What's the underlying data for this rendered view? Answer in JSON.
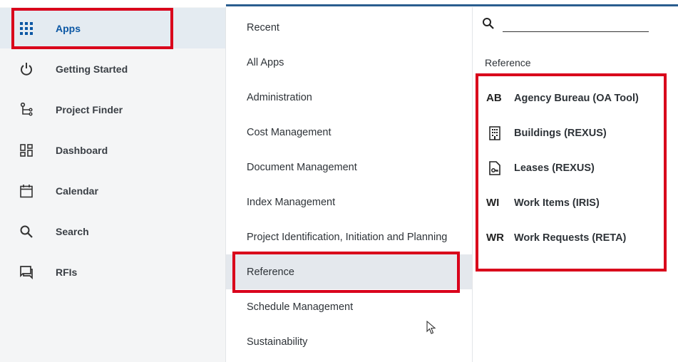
{
  "nav": {
    "items": [
      {
        "label": "Apps",
        "icon": "apps-grid-icon",
        "active": true
      },
      {
        "label": "Getting Started",
        "icon": "power-icon"
      },
      {
        "label": "Project Finder",
        "icon": "tree-icon"
      },
      {
        "label": "Dashboard",
        "icon": "dashboard-icon"
      },
      {
        "label": "Calendar",
        "icon": "calendar-icon"
      },
      {
        "label": "Search",
        "icon": "search-icon"
      },
      {
        "label": "RFIs",
        "icon": "rfi-icon"
      }
    ]
  },
  "categories": {
    "items": [
      "Recent",
      "All Apps",
      "Administration",
      "Cost Management",
      "Document Management",
      "Index Management",
      "Project Identification, Initiation and Planning",
      "Reference",
      "Schedule Management",
      "Sustainability"
    ],
    "selected": "Reference"
  },
  "results": {
    "search": {
      "value": "",
      "placeholder": ""
    },
    "section_title": "Reference",
    "apps": [
      {
        "abbr": "AB",
        "label": "Agency Bureau (OA Tool)"
      },
      {
        "abbr": "",
        "icon": "building-icon",
        "label": "Buildings (REXUS)"
      },
      {
        "abbr": "",
        "icon": "lease-document-icon",
        "label": "Leases (REXUS)"
      },
      {
        "abbr": "WI",
        "label": "Work Items (IRIS)"
      },
      {
        "abbr": "WR",
        "label": "Work Requests (RETA)"
      }
    ]
  },
  "colors": {
    "accent": "#0b57a4",
    "highlight": "#d9001b",
    "topline": "#2a5d8f",
    "nav_bg": "#f4f5f6",
    "active_bg": "#e4ebf1"
  }
}
